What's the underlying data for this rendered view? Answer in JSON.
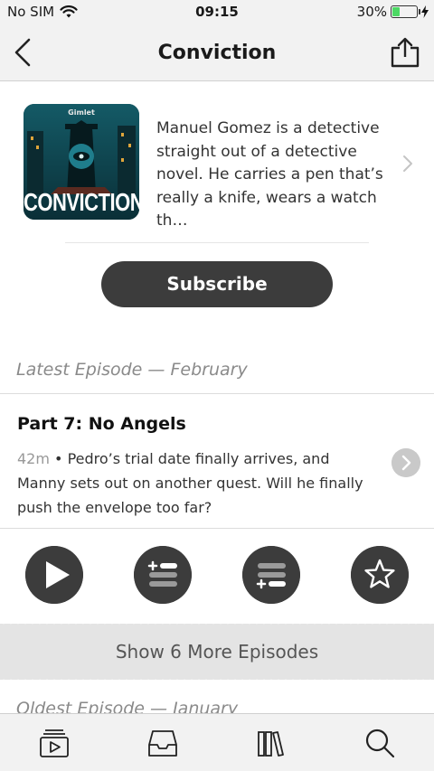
{
  "status_bar": {
    "carrier": "No SIM",
    "time": "09:15",
    "battery": "30%",
    "battery_level": 0.3,
    "wifi_icon": "wifi-icon"
  },
  "nav": {
    "title": "Conviction",
    "back_icon": "chevron-left-icon",
    "share_icon": "share-icon"
  },
  "podcast": {
    "artwork_brand": "Gimlet",
    "artwork_title": "CONVICTION",
    "description": "Manuel Gomez is a detective straight out of a detective novel. He carries a pen that’s really a knife, wears a watch th…",
    "subscribe_label": "Subscribe"
  },
  "latest_label": "Latest Episode — February",
  "episode": {
    "title": "Part 7: No Angels",
    "duration": "42m",
    "separator": " • ",
    "description": "Pedro’s trial date finally arrives, and Manny sets out on another quest. Will he finally push the envelope too far?"
  },
  "actions": [
    {
      "name": "play-icon"
    },
    {
      "name": "play-next-icon"
    },
    {
      "name": "play-later-icon"
    },
    {
      "name": "star-icon"
    }
  ],
  "show_more_label": "Show 6 More Episodes",
  "oldest_label": "Oldest Episode — January",
  "tabs": [
    {
      "name": "unplayed-icon"
    },
    {
      "name": "inbox-icon"
    },
    {
      "name": "library-icon"
    },
    {
      "name": "search-icon"
    }
  ],
  "colors": {
    "button": "#3c3c3c",
    "battery": "#4cd964",
    "bar_background": "#f2f2f2"
  }
}
